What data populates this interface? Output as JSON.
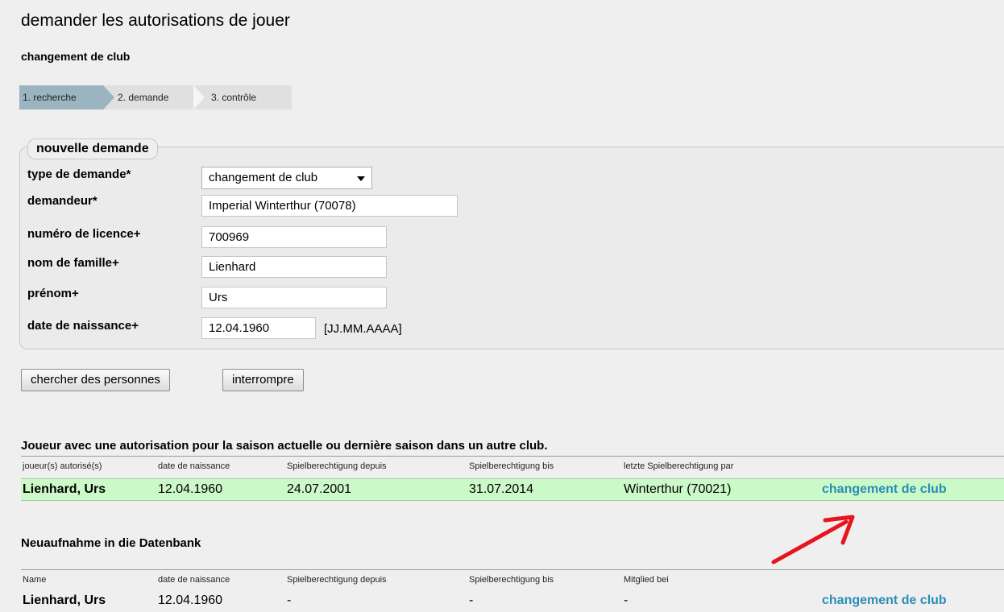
{
  "page": {
    "title": "demander les autorisations de jouer",
    "section": "changement de club"
  },
  "steps": [
    {
      "label": "1. recherche"
    },
    {
      "label": "2. demande"
    },
    {
      "label": "3. contrôle"
    }
  ],
  "form": {
    "legend": "nouvelle demande",
    "type": {
      "label": "type de demande*",
      "value": "changement de club"
    },
    "applicant": {
      "label": "demandeur*",
      "value": "Imperial Winterthur (70078)"
    },
    "license": {
      "label": "numéro de licence+",
      "value": "700969"
    },
    "lastname": {
      "label": "nom de famille+",
      "value": "Lienhard"
    },
    "firstname": {
      "label": "prénom+",
      "value": "Urs"
    },
    "birthdate": {
      "label": "date de naissance+",
      "value": "12.04.1960",
      "hint": "[JJ.MM.AAAA]"
    }
  },
  "buttons": {
    "search": "chercher des personnes",
    "cancel": "interrompre"
  },
  "table1": {
    "title": "Joueur avec une autorisation pour la saison actuelle ou dernière saison dans un autre club.",
    "headers": [
      "joueur(s) autorisé(s)",
      "date de naissance",
      "Spielberechtigung depuis",
      "Spielberechtigung bis",
      "letzte Spielberechtigung par"
    ],
    "row": {
      "name": "Lienhard, Urs",
      "birth": "12.04.1960",
      "from": "24.07.2001",
      "to": "31.07.2014",
      "club": "Winterthur (70021)",
      "action": "changement de club"
    }
  },
  "table2": {
    "title": "Neuaufnahme in die Datenbank",
    "headers": [
      "Name",
      "date de naissance",
      "Spielberechtigung depuis",
      "Spielberechtigung bis",
      "Mitglied bei"
    ],
    "row": {
      "name": "Lienhard, Urs",
      "birth": "12.04.1960",
      "from": "-",
      "to": "-",
      "member": "-",
      "action": "changement de club"
    }
  },
  "colors": {
    "accent_link": "#2a8db4",
    "row_highlight": "#ccf9c8",
    "step_active": "#9ab4c0",
    "annotation_arrow": "#e8141b"
  },
  "icons": {
    "dropdown": "chevron-down-icon",
    "annotation": "red-arrow-icon"
  }
}
